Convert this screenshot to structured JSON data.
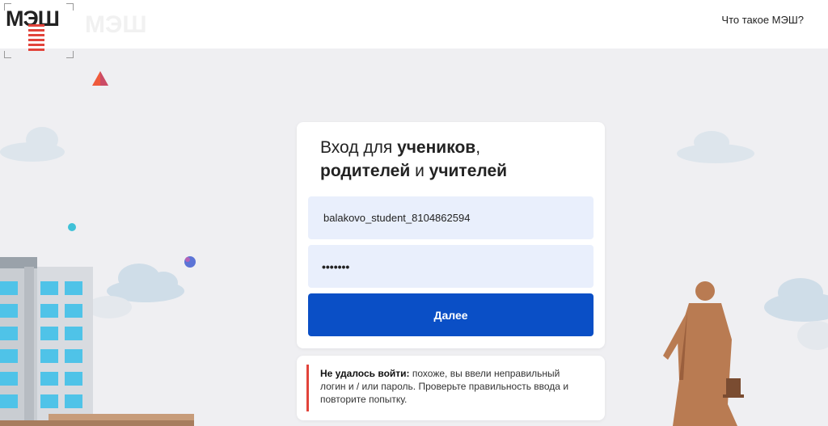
{
  "header": {
    "logo_text": "МЭШ",
    "what_link": "Что такое МЭШ?"
  },
  "login": {
    "title_prefix": "Вход для ",
    "title_bold1": "учеников",
    "title_comma": ",",
    "title_bold2": "родителей",
    "title_and": " и ",
    "title_bold3": "учителей",
    "login_value": "balakovo_student_8104862594",
    "password_value": "•••••••",
    "submit_label": "Далее"
  },
  "error": {
    "heading": "Не удалось войти:",
    "message": " похоже, вы ввели неправильный логин и / или пароль. Проверьте правильность ввода и повторите попытку."
  },
  "colors": {
    "primary": "#0a4fc6",
    "error_accent": "#e2443b",
    "field_bg": "#e9effc",
    "page_bg": "#efeff2"
  }
}
